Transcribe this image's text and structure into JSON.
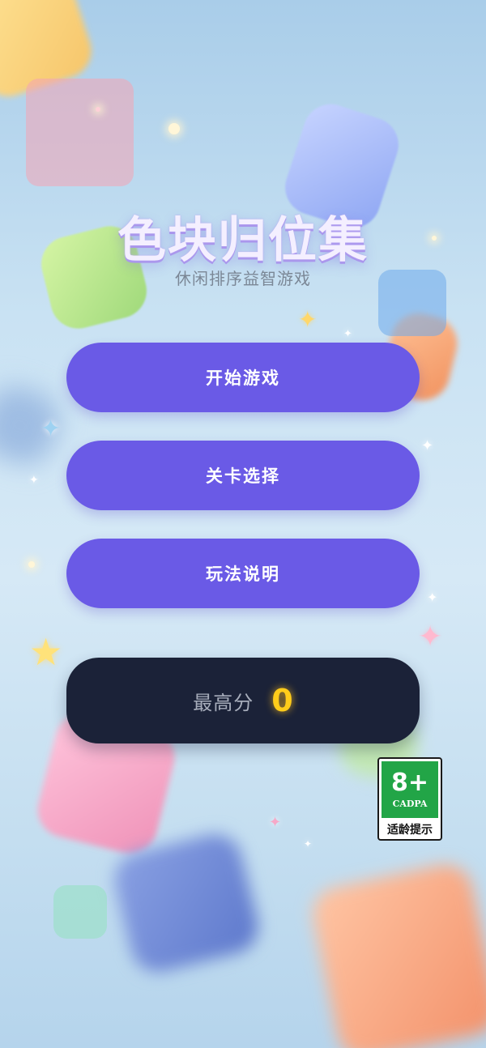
{
  "game": {
    "title": "色块归位集",
    "subtitle": "休闲排序益智游戏"
  },
  "menu": {
    "start_label": "开始游戏",
    "level_select_label": "关卡选择",
    "how_to_play_label": "玩法说明"
  },
  "score": {
    "label": "最高分",
    "value": "0"
  },
  "age_rating": {
    "age": "8+",
    "org": "CADPA",
    "tip": "适龄提示"
  },
  "colors": {
    "button": "#6a5ae6",
    "score_panel": "#1b2238",
    "score_value": "#ffcc1a",
    "rating_green": "#22a547"
  }
}
